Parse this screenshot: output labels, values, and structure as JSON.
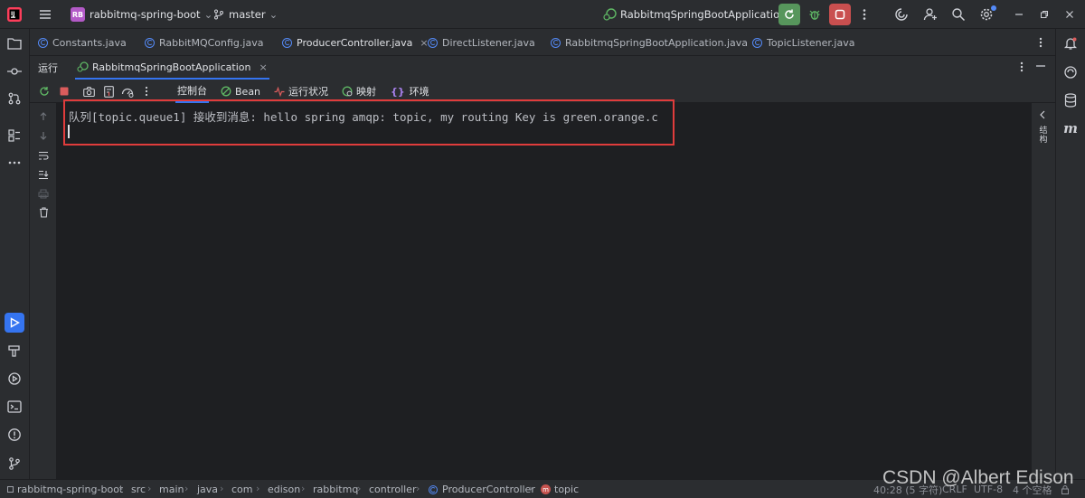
{
  "titlebar": {
    "project_badge": "RB",
    "project_name": "rabbitmq-spring-boot",
    "branch": "master",
    "run_config": "RabbitmqSpringBootApplication"
  },
  "editor_tabs": [
    {
      "label": "Constants.java"
    },
    {
      "label": "RabbitMQConfig.java"
    },
    {
      "label": "ProducerController.java",
      "active": true
    },
    {
      "label": "DirectListener.java"
    },
    {
      "label": "RabbitmqSpringBootApplication.java"
    },
    {
      "label": "TopicListener.java"
    }
  ],
  "run_panel": {
    "title": "运行",
    "session_tab": "RabbitmqSpringBootApplication",
    "tabs": [
      "控制台",
      "Bean",
      "运行状况",
      "映射",
      "环境"
    ],
    "active_tab": "控制台"
  },
  "console": {
    "line": "队列[topic.queue1] 接收到消息: hello spring amqp: topic, my routing Key is green.orange.c"
  },
  "right_strip": {
    "vertical_label": "结构"
  },
  "breadcrumb": [
    "rabbitmq-spring-boot",
    "src",
    "main",
    "java",
    "com",
    "edison",
    "rabbitmq",
    "controller",
    "ProducerController",
    "topic"
  ],
  "status": {
    "position": "40:28 (5 字符)",
    "line_ending": "CRLF",
    "encoding": "UTF-8",
    "indent": "4 个空格"
  },
  "watermark": "CSDN @Albert Edison",
  "colors": {
    "accent": "#548af7",
    "highlight": "#e03c3c",
    "run_green": "#5fb865",
    "stop_red": "#db5c5c"
  }
}
